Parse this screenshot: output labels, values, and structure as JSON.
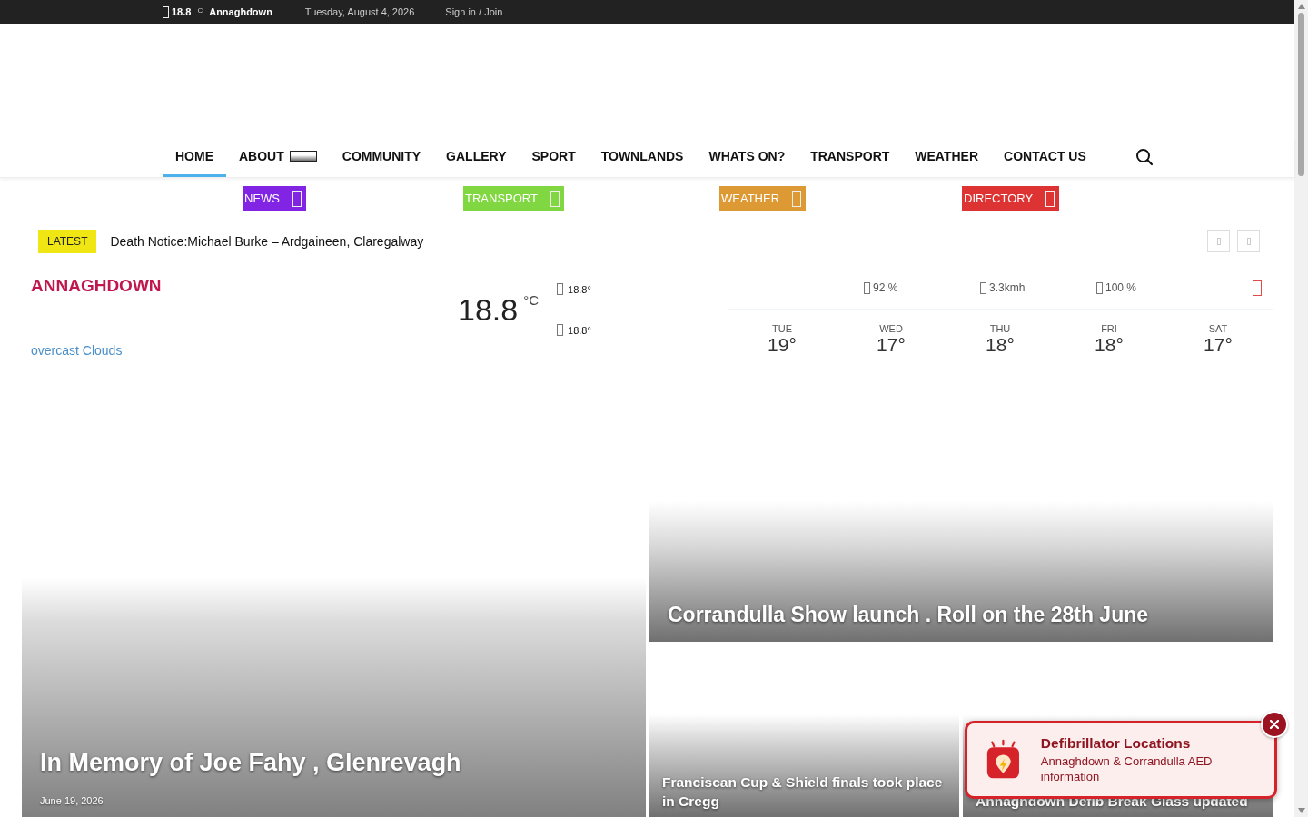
{
  "top_bar": {
    "temperature": "18.8",
    "unit": "C",
    "location": "Annaghdown",
    "date": "Tuesday, August 4, 2026",
    "sign_in": "Sign in / Join"
  },
  "nav": {
    "items": [
      {
        "label": "HOME",
        "selected": true,
        "dropdown": false
      },
      {
        "label": "ABOUT",
        "selected": false,
        "dropdown": true
      },
      {
        "label": "COMMUNITY",
        "selected": false,
        "dropdown": false
      },
      {
        "label": "GALLERY",
        "selected": false,
        "dropdown": false
      },
      {
        "label": "SPORT",
        "selected": false,
        "dropdown": false
      },
      {
        "label": "TOWNLANDS",
        "selected": false,
        "dropdown": false
      },
      {
        "label": "WHATS ON?",
        "selected": false,
        "dropdown": false
      },
      {
        "label": "TRANSPORT",
        "selected": false,
        "dropdown": false
      },
      {
        "label": "WEATHER",
        "selected": false,
        "dropdown": false
      },
      {
        "label": "CONTACT US",
        "selected": false,
        "dropdown": false
      }
    ]
  },
  "categories": [
    {
      "label": "NEWS",
      "color": "#8224e3"
    },
    {
      "label": "TRANSPORT",
      "color": "#81d742"
    },
    {
      "label": "WEATHER",
      "color": "#dd9933"
    },
    {
      "label": "DIRECTORY",
      "color": "#dd3333"
    }
  ],
  "latest": {
    "label": "LATEST",
    "headline": "Death Notice:Michael Burke – Ardgaineen, Claregalway"
  },
  "weather": {
    "location": "ANNAGHDOWN",
    "description": "overcast Clouds",
    "temperature": "18.8",
    "unit": "°C",
    "high": "18.8°",
    "low": "18.8°",
    "stats": [
      "92 %",
      "3.3kmh",
      "100 %"
    ],
    "forecast": [
      {
        "day": "TUE",
        "temp": "19°"
      },
      {
        "day": "WED",
        "temp": "17°"
      },
      {
        "day": "THU",
        "temp": "18°"
      },
      {
        "day": "FRI",
        "temp": "18°"
      },
      {
        "day": "SAT",
        "temp": "17°"
      }
    ]
  },
  "articles": [
    {
      "kind": "large",
      "title": "In Memory of Joe Fahy , Glenrevagh",
      "date": "June 19, 2026"
    },
    {
      "kind": "wide",
      "title": "Corrandulla Show launch . Roll on the 28th June"
    },
    {
      "kind": "small",
      "title": "Franciscan Cup & Shield finals took place in Cregg"
    },
    {
      "kind": "small",
      "title": "Annaghdown Defib Break Glass updated"
    }
  ],
  "popup": {
    "title": "Defibrillator Locations",
    "text": "Annaghdown & Corrandulla AED information"
  }
}
